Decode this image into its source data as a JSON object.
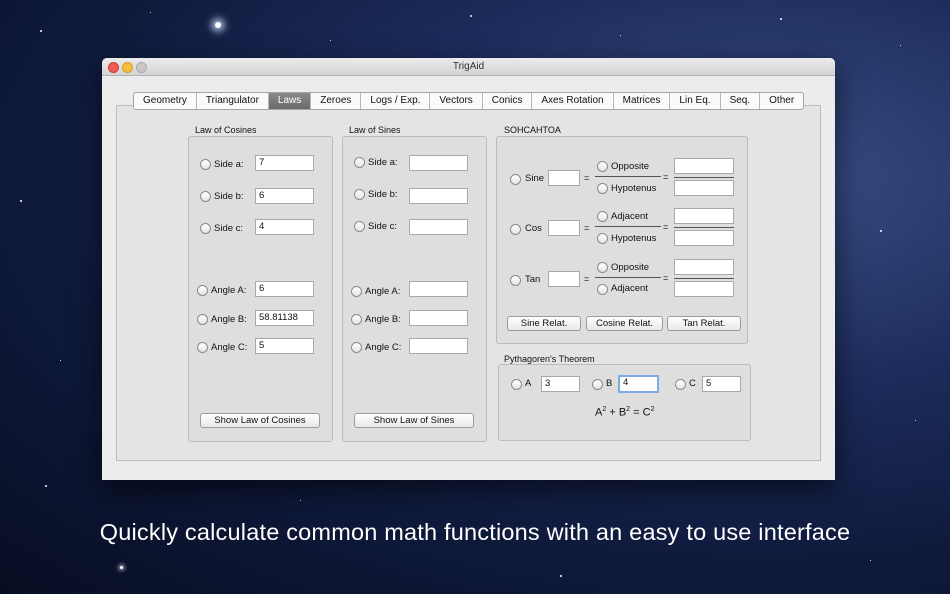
{
  "window": {
    "title": "TrigAid"
  },
  "tabs": [
    "Geometry",
    "Triangulator",
    "Laws",
    "Zeroes",
    "Logs / Exp.",
    "Vectors",
    "Conics",
    "Axes Rotation",
    "Matrices",
    "Lin Eq.",
    "Seq.",
    "Other"
  ],
  "active_tab": "Laws",
  "cosines": {
    "title": "Law of Cosines",
    "side_a_label": "Side a:",
    "side_a_value": "7",
    "side_b_label": "Side b:",
    "side_b_value": "6",
    "side_c_label": "Side c:",
    "side_c_value": "4",
    "angle_a_label": "Angle A:",
    "angle_a_value": "6",
    "angle_b_label": "Angle B:",
    "angle_b_value": "58.81138",
    "angle_c_label": "Angle C:",
    "angle_c_value": "5",
    "button": "Show Law of Cosines"
  },
  "sines": {
    "title": "Law of Sines",
    "side_a_label": "Side a:",
    "side_a_value": "",
    "side_b_label": "Side b:",
    "side_b_value": "",
    "side_c_label": "Side c:",
    "side_c_value": "",
    "angle_a_label": "Angle A:",
    "angle_a_value": "",
    "angle_b_label": "Angle B:",
    "angle_b_value": "",
    "angle_c_label": "Angle C:",
    "angle_c_value": "",
    "button": "Show Law of Sines"
  },
  "sohcahtoa": {
    "title": "SOHCAHTOA",
    "sine_label": "Sine",
    "sine_top": "Opposite",
    "sine_bottom": "Hypotenus",
    "cos_label": "Cos",
    "cos_top": "Adjacent",
    "cos_bottom": "Hypotenus",
    "tan_label": "Tan",
    "tan_top": "Opposite",
    "tan_bottom": "Adjacent",
    "equals": "=",
    "btn_sine": "Sine Relat.",
    "btn_cos": "Cosine Relat.",
    "btn_tan": "Tan Relat."
  },
  "pythagoras": {
    "title": "Pythagoren's Theorem",
    "a_label": "A",
    "a_value": "3",
    "b_label": "B",
    "b_value": "4",
    "c_label": "C",
    "c_value": "5",
    "formula_a": "A",
    "formula_b": "B",
    "formula_c": "C",
    "exp": "2",
    "plus": "+",
    "equals": "="
  },
  "caption": "Quickly calculate common math functions with an easy to use interface"
}
